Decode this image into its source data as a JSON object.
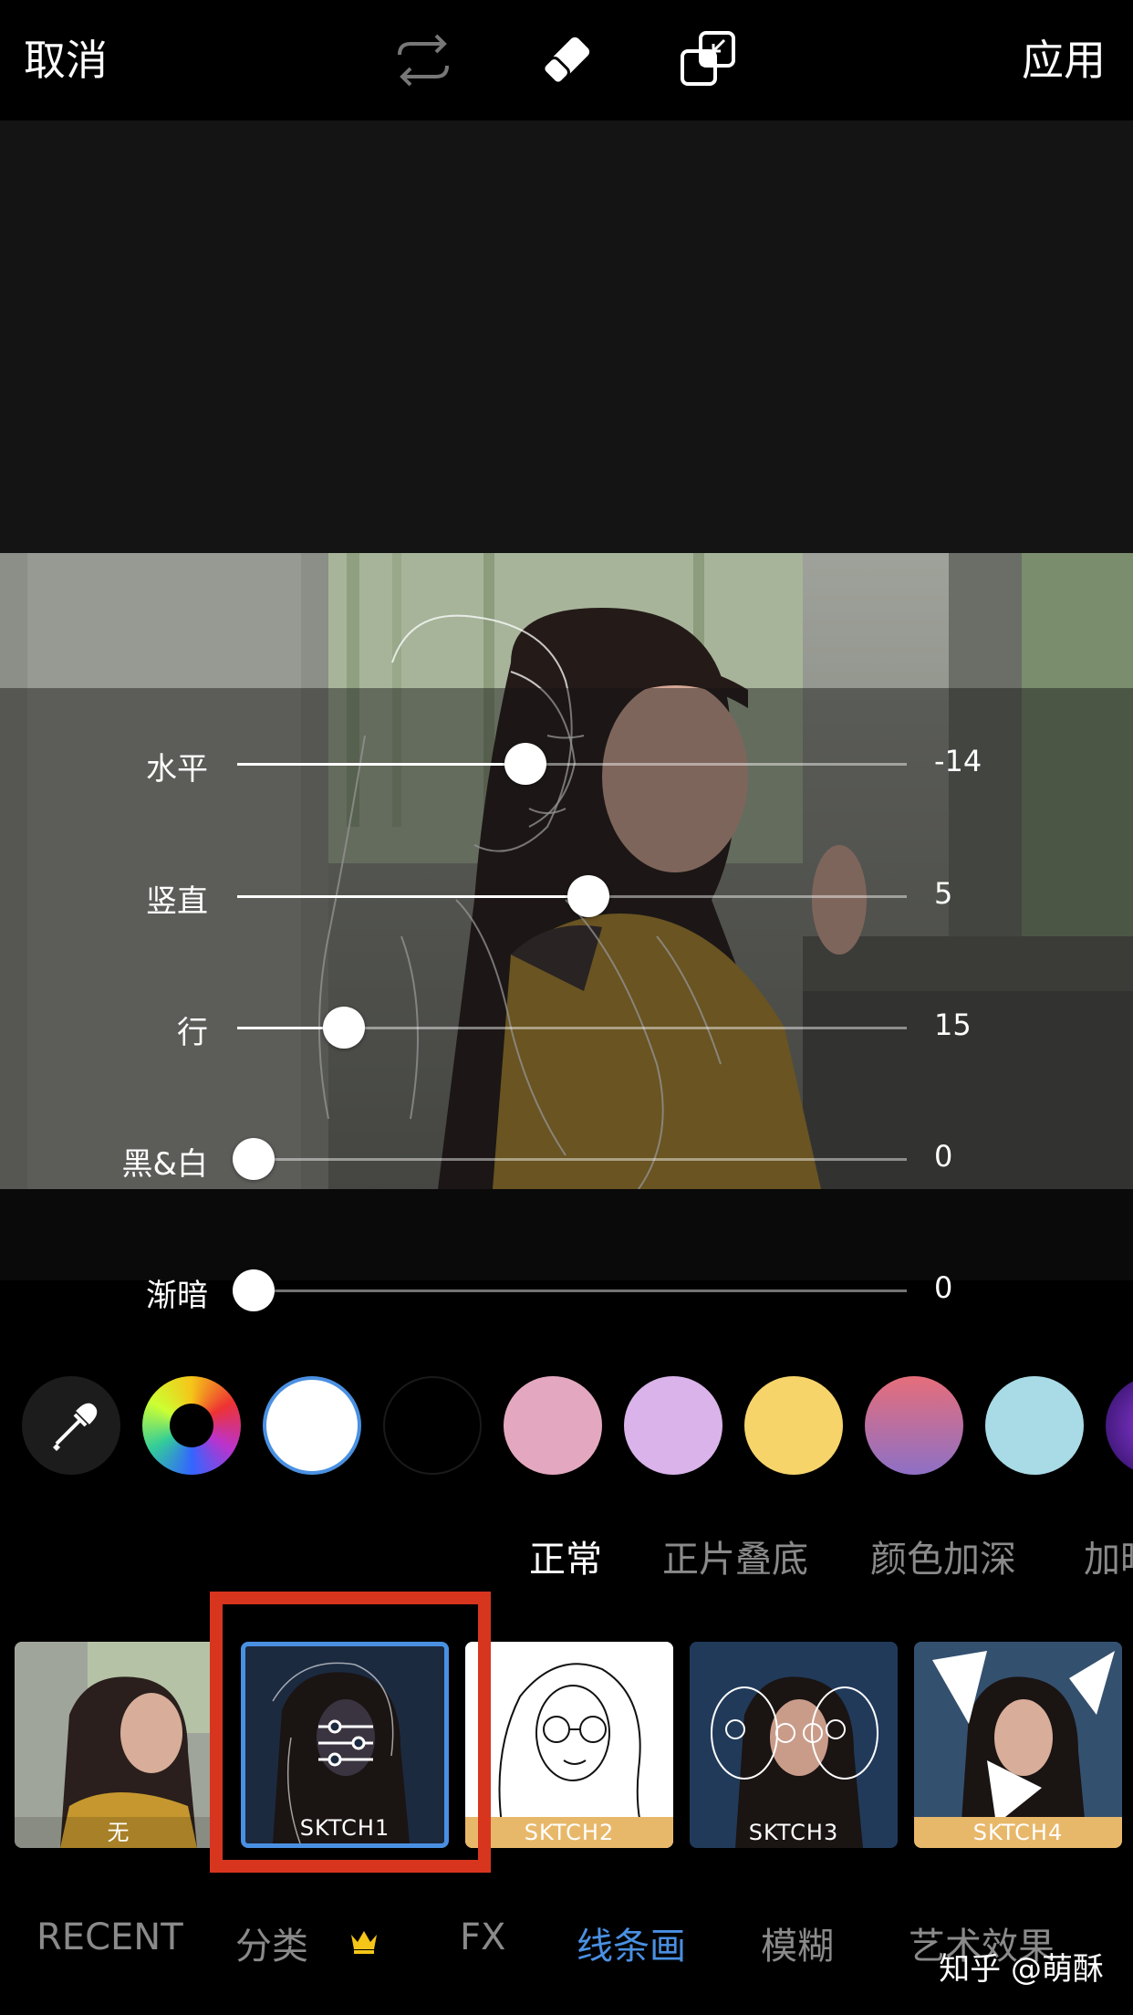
{
  "topbar": {
    "cancel_label": "取消",
    "apply_label": "应用"
  },
  "sliders": [
    {
      "label": "水平",
      "value": "-14",
      "level": 0.43
    },
    {
      "label": "竖直",
      "value": "5",
      "level": 0.525
    },
    {
      "label": "行",
      "value": "15",
      "level": 0.16
    },
    {
      "label": "黑&白",
      "value": "0",
      "level": 0.025
    },
    {
      "label": "渐暗",
      "value": "0",
      "level": 0.025
    }
  ],
  "swatches": {
    "colors": [
      "#e3a8c0",
      "#d9b3ea",
      "#f6d46a",
      "#e66e7a",
      "#a8dbe6"
    ],
    "selected": "white"
  },
  "blend_modes": [
    "正常",
    "正片叠底",
    "颜色加深",
    "加暗"
  ],
  "blend_active": "正常",
  "filters": [
    {
      "label": "无"
    },
    {
      "label": "SKTCH1"
    },
    {
      "label": "SKTCH2"
    },
    {
      "label": "SKTCH3"
    },
    {
      "label": "SKTCH4"
    }
  ],
  "tabs": [
    "RECENT",
    "分类",
    "FX",
    "线条画",
    "模糊",
    "艺术效果"
  ],
  "active_tab": "线条画",
  "watermark": "知乎 @萌酥",
  "colors": {
    "accent": "#4a90e2",
    "highlight": "#d8351f",
    "crown": "#f5c518"
  }
}
